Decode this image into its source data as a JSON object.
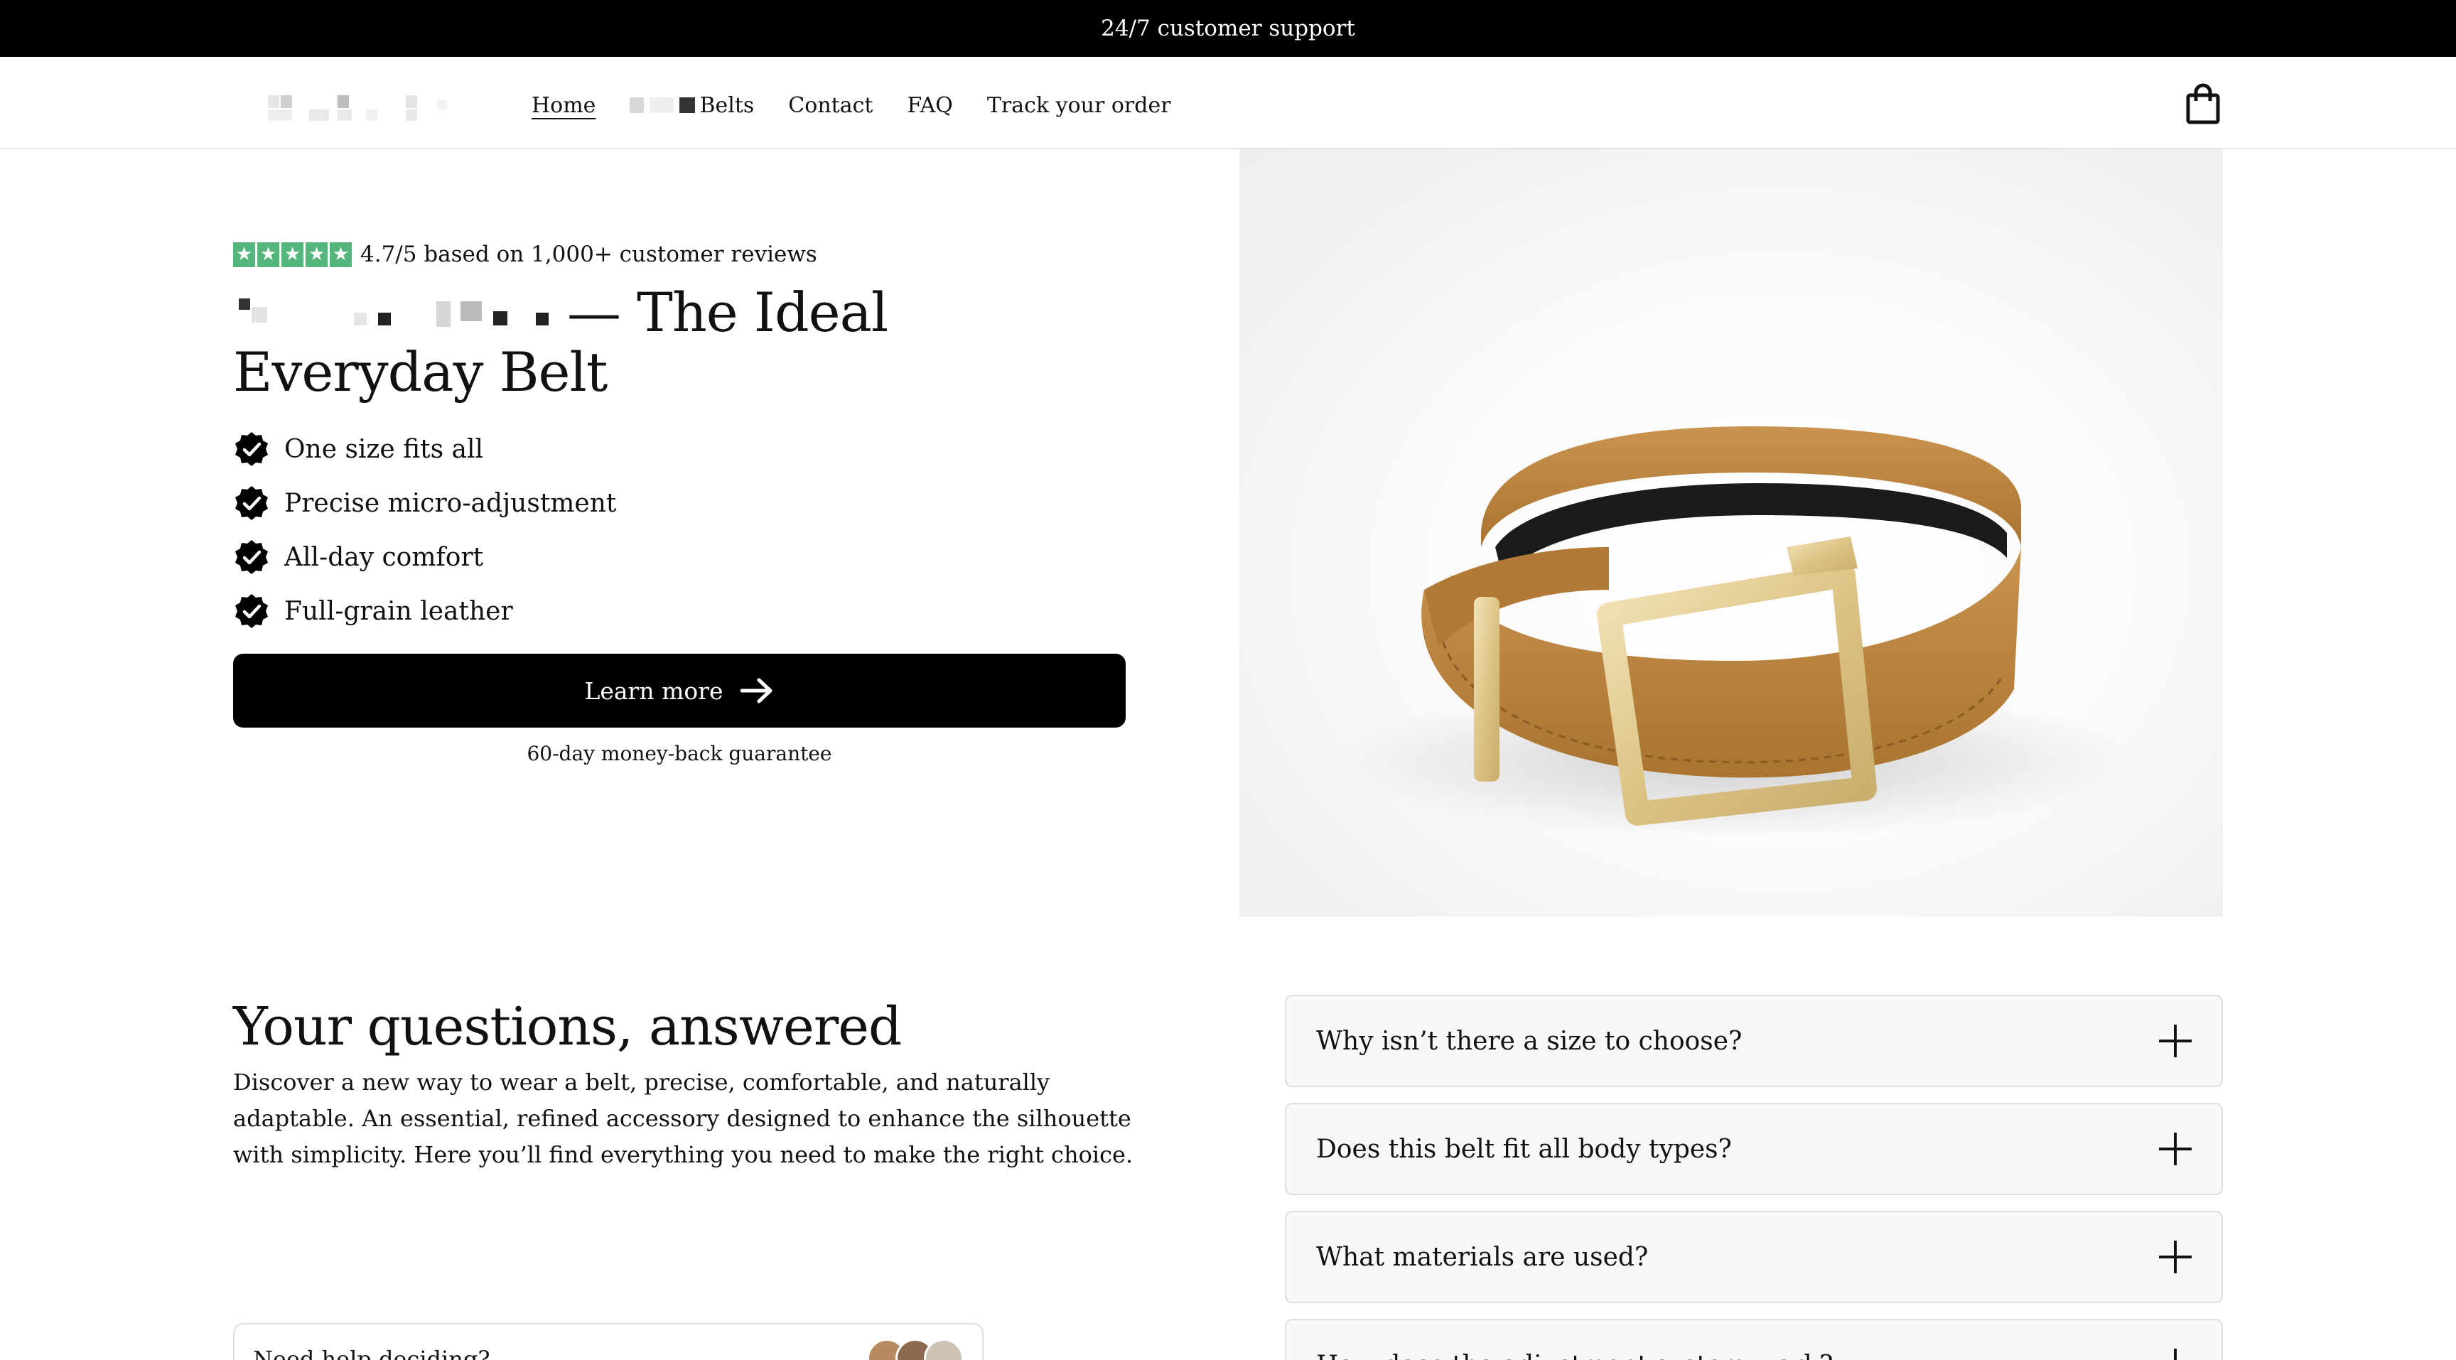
{
  "announcement": "24/7 customer support",
  "nav": {
    "items": [
      {
        "label": "Home",
        "active": true
      },
      {
        "label": "Belts",
        "active": false
      },
      {
        "label": "Contact",
        "active": false
      },
      {
        "label": "FAQ",
        "active": false
      },
      {
        "label": "Track your order",
        "active": false
      }
    ]
  },
  "icons": {
    "cart": "shopping-bag-icon",
    "check": "check-badge-icon",
    "arrow": "arrow-right-icon",
    "plus": "plus-icon",
    "star": "star-icon"
  },
  "hero": {
    "rating_stars": 5,
    "rating_text": "4.7/5 based on 1,000+ customer reviews",
    "title_suffix": "— The Ideal Everyday Belt",
    "features": [
      "One size fits all",
      "Precise micro-adjustment",
      "All-day comfort",
      "Full-grain leather"
    ],
    "cta_label": "Learn more",
    "guarantee": "60-day money-back guarantee"
  },
  "faq": {
    "title": "Your questions, answered",
    "description": "Discover a new way to wear a belt, precise, comfortable, and naturally adaptable. An essential, refined accessory designed to enhance the silhouette with simplicity. Here you’ll find everything you need to make the right choice.",
    "help_label": "Need help deciding?",
    "questions": [
      "Why isn’t there a size to choose?",
      "Does this belt fit all body types?",
      "What materials are used?",
      "How does the adjustment system work?"
    ]
  },
  "colors": {
    "star_green": "#54b67c",
    "black": "#000000",
    "belt_leather": "#b8823f",
    "buckle_gold": "#e4cf98"
  }
}
